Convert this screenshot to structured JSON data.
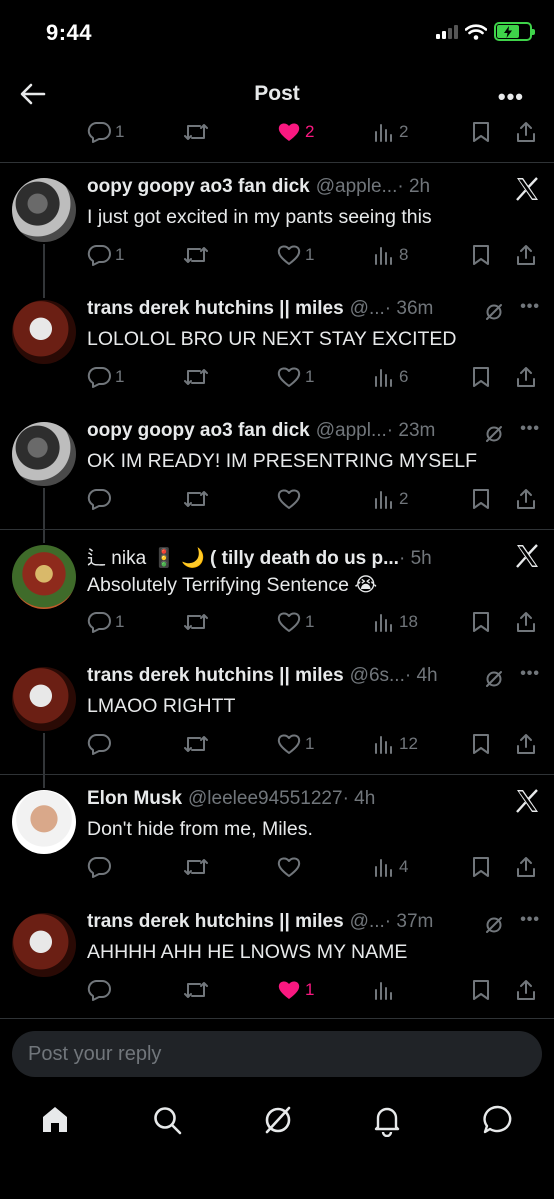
{
  "status_bar": {
    "time": "9:44"
  },
  "header": {
    "title": "Post",
    "back_icon": "arrow-left-icon",
    "more_icon": "more-dots-icon"
  },
  "top_actions": {
    "replies": "1",
    "reposts": "",
    "likes": "2",
    "views": "2"
  },
  "posts": [
    {
      "name": "oopy goopy ao3 fan dick",
      "handle": "@apple...",
      "time": "· 2h",
      "text": "I just got excited in my pants seeing this",
      "replies": "1",
      "reposts": "",
      "likes": "1",
      "views": "8",
      "liked": false,
      "corner": "x-logo"
    },
    {
      "name": "trans derek hutchins || miles",
      "handle": "@...",
      "time": "· 36m",
      "text": "LOLOLOL BRO UR NEXT STAY EXCITED",
      "replies": "1",
      "reposts": "",
      "likes": "1",
      "views": "6",
      "liked": false,
      "corner": "grok-more"
    },
    {
      "name": "oopy goopy ao3 fan dick",
      "handle": "@appl...",
      "time": "· 23m",
      "text": "OK IM READY! IM PRESENTRING MYSELF",
      "replies": "",
      "reposts": "",
      "likes": "",
      "views": "2",
      "liked": false,
      "corner": "grok-more"
    },
    {
      "name_prefix": "⻍ nika",
      "name": "🚦 🌙 ( tilly death do us p...",
      "handle": "",
      "time": "· 5h",
      "text": "Absolutely Terrifying Sentence 😭",
      "replies": "1",
      "reposts": "",
      "likes": "1",
      "views": "18",
      "liked": false,
      "corner": "x-logo"
    },
    {
      "name": "trans derek hutchins || miles",
      "handle": "@6s...",
      "time": "· 4h",
      "text": "LMAOO RIGHTT",
      "replies": "",
      "reposts": "",
      "likes": "1",
      "views": "12",
      "liked": false,
      "corner": "grok-more"
    },
    {
      "name": "Elon Musk",
      "handle": "@leelee94551227",
      "time": "· 4h",
      "text": "Don't hide from me, Miles.",
      "replies": "",
      "reposts": "",
      "likes": "",
      "views": "4",
      "liked": false,
      "corner": "x-logo"
    },
    {
      "name": "trans derek hutchins || miles",
      "handle": "@...",
      "time": "· 37m",
      "text": "AHHHH AHH HE LNOWS MY NAME",
      "replies": "",
      "reposts": "",
      "likes": "1",
      "views": "",
      "liked": true,
      "corner": "grok-more"
    }
  ],
  "reply_bar": {
    "placeholder": "Post your reply"
  },
  "tabs": [
    "home-icon",
    "search-icon",
    "grok-icon",
    "notifications-icon",
    "messages-icon"
  ],
  "colors": {
    "background": "#000000",
    "text": "#e7e9ea",
    "muted": "#71767b",
    "like": "#f91880",
    "divider": "#2f3336"
  }
}
